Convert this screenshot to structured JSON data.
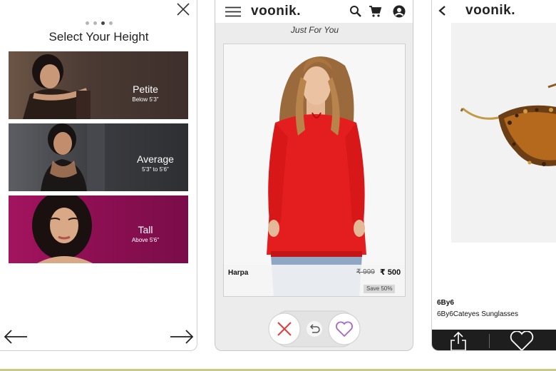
{
  "height_screen": {
    "title": "Select Your Height",
    "step_dots": 4,
    "active_dot": 3,
    "options": [
      {
        "name": "Petite",
        "size": "Below 5'3\""
      },
      {
        "name": "Average",
        "size": "5'3\" to 5'6\""
      },
      {
        "name": "Tall",
        "size": "Above 5'6\""
      }
    ]
  },
  "feed_screen": {
    "logo": "voonik.",
    "subtitle": "Just For You",
    "product": {
      "name": "Harpa",
      "original_price": "₹ 999",
      "price": "₹ 500",
      "discount": "Save 50%"
    }
  },
  "detail_screen": {
    "logo": "voonik.",
    "brand": "6By6",
    "product_title": "6By6Cateyes Sunglasses"
  },
  "colors": {
    "reject": "#e33b3b",
    "like": "#a868c8",
    "top_color": "#e41e1e",
    "footer": "#1e1e1e"
  }
}
